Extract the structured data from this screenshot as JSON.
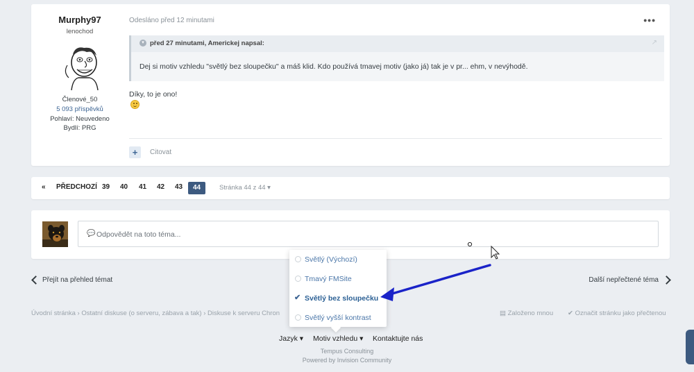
{
  "post": {
    "author": "Murphy97",
    "rank": "lenochod",
    "group": "Členové_50",
    "posts": "5 093 příspěvků",
    "gender": "Pohlaví: Neuvedeno",
    "location": "Bydlí: PRG",
    "posted": "Odesláno před 12 minutami",
    "more": "•••",
    "quote_header": "před 27 minutami, Americkej napsal:",
    "quote_text": "Dej si motiv vzhledu \"světlý bez sloupečku\" a máš klid. Kdo používá tmavej motiv (jako já) tak je v pr... ehm, v nevýhodě.",
    "text": "Díky, to je ono!",
    "quote_button": "Citovat"
  },
  "pagination": {
    "first": "«",
    "prev": "PŘEDCHOZÍ",
    "pages": [
      "39",
      "40",
      "41",
      "42",
      "43"
    ],
    "current": "44",
    "page_select": "Stránka 44 z 44 ▾"
  },
  "reply": {
    "placeholder": "Odpovědět na toto téma..."
  },
  "nav": {
    "back": "Přejít na přehled témat",
    "next": "Další nepřečtené téma"
  },
  "breadcrumb": {
    "items": [
      "Úvodní stránka",
      "Ostatní diskuse (o serveru, zábava a tak)",
      "Diskuse k serveru Chron"
    ],
    "started_by_me": "Založeno mnou",
    "mark_read": "Označit stránku jako přečtenou"
  },
  "theme_menu": {
    "items": [
      {
        "label": "Světlý (Výchozí)",
        "selected": false
      },
      {
        "label": "Tmavý FMSite",
        "selected": false
      },
      {
        "label": "Světlý bez sloupečku",
        "selected": true
      },
      {
        "label": "Světlý vyšší kontrast",
        "selected": false
      }
    ]
  },
  "footer": {
    "language": "Jazyk ▾",
    "theme": "Motiv vzhledu ▾",
    "contact": "Kontaktujte nás",
    "company": "Tempus Consulting",
    "powered": "Powered by Invision Community"
  },
  "colors": {
    "accent": "#3d5a80",
    "link": "#3d6594",
    "arrow": "#1a23c8"
  }
}
